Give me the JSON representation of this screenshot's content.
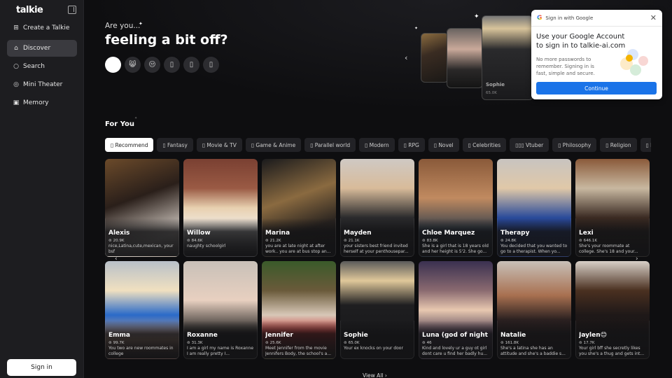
{
  "sidebar": {
    "logo": "talkie",
    "items": [
      {
        "label": "Create a Talkie",
        "icon": "plus-square-icon",
        "glyph": "⊞"
      },
      {
        "label": "Discover",
        "icon": "home-icon",
        "glyph": "⌂",
        "active": true
      },
      {
        "label": "Search",
        "icon": "search-icon",
        "glyph": "○"
      },
      {
        "label": "Mini Theater",
        "icon": "theater-icon",
        "glyph": "◎"
      },
      {
        "label": "Memory",
        "icon": "memory-icon",
        "glyph": "▣"
      }
    ],
    "signin_label": "Sign in"
  },
  "hero": {
    "subtitle": "Are you...",
    "title": "feeling a bit off?",
    "moods": [
      "",
      "😸",
      "😒",
      "▯",
      "▯",
      "▯"
    ],
    "featured_name": "Sophie",
    "featured_stat": "65.0K"
  },
  "google_popup": {
    "header": "Sign in with Google",
    "title": "Use your Google Account to sign in to talkie-ai.com",
    "description": "No more passwords to remember. Signing in is fast, simple and secure.",
    "button": "Continue"
  },
  "for_you": {
    "title": "For You",
    "categories": [
      "▯ Recommend",
      "▯ Fantasy",
      "▯ Movie & TV",
      "▯ Game & Anime",
      "▯ Parallel world",
      "▯ Modern",
      "▯ RPG",
      "▯ Novel",
      "▯ Celebrities",
      "▯▯▯ Vtuber",
      "▯ Philosophy",
      "▯ Religion",
      "▯ Politics",
      ""
    ],
    "cards": [
      {
        "name": "Alexis",
        "stat": "20.9K",
        "desc": "nice,Latina,cute,mexican, your bsf",
        "bg": "linear-gradient(160deg,#6b4a2a 0%,#2a1f1a 40%,#d8d0c8 80%,#b8aca0 100%)"
      },
      {
        "name": "Willow",
        "stat": "84.6K",
        "desc": "naughty schoolgirl",
        "bg": "linear-gradient(180deg,#7a4032 0%,#9a5a44 30%,#e8d0b0 50%,#f2f0ee 75%,#2a2a2e 100%)"
      },
      {
        "name": "Marina",
        "stat": "21.2K",
        "desc": "you are at late night at after work.. you are at bus stop an...",
        "bg": "linear-gradient(160deg,#1a1a1c 0%,#8a6a40 40%,#2a2420 70%,#151515 100%)"
      },
      {
        "name": "Mayden",
        "stat": "21.1K",
        "desc": "your sisters best friend invited herself at your penthousepar...",
        "bg": "linear-gradient(180deg,#cfc9c4 0%,#d8bb9a 30%,#2a2a2c 60%,#1e1e20 100%)"
      },
      {
        "name": "Chloe Marquez",
        "stat": "83.8K",
        "desc": "She is a girl that is 18 years old and her height is 5'2. She go...",
        "bg": "linear-gradient(180deg,#8a5a3a 0%,#c08a60 40%,#2a3a4a 75%,#1a2028 100%)"
      },
      {
        "name": "Therapy",
        "stat": "24.8K",
        "desc": "You decided that you wanted to go to a therapist. When yo...",
        "bg": "linear-gradient(180deg,#c8c4c0 0%,#e0c8a8 30%,#2a4a9a 60%,#203060 100%)"
      },
      {
        "name": "Lexi",
        "stat": "646.1K",
        "desc": "She's your roommate at college. She's 18 and your...",
        "bg": "linear-gradient(180deg,#8a5a3a 0%,#c8b8a0 30%,#3a2a22 60%,#1a1816 100%)"
      },
      {
        "name": "Emma",
        "stat": "99.7K",
        "desc": "You two are new roommates in college",
        "bg": "linear-gradient(180deg,#b8c0c8 0%,#f0e0c0 30%,#2a6ac8 55%,#d8a888 80%,#3a2a2a 100%)"
      },
      {
        "name": "Roxanne",
        "stat": "31.3K",
        "desc": "I am a girl my name is Roxanne I am really pretty I...",
        "bg": "linear-gradient(180deg,#c8c0b8 0%,#e8d0c0 40%,#1a1a1a 75%,#141414 100%)"
      },
      {
        "name": "Jennifer",
        "stat": "25.6K",
        "desc": "Meet Jennifer from the movie Jennifers Body, the school's a...",
        "bg": "linear-gradient(180deg,#3a5a2a 0%,#6a5a3a 30%,#d8c8b8 55%,#c82a2a 75%,#2a2a1e 100%)"
      },
      {
        "name": "Sophie",
        "stat": "65.0K",
        "desc": "Your ex knocks on your door",
        "bg": "linear-gradient(180deg,#5a5a5a 0%,#e0c89a 20%,#1e1e20 45%,#161618 100%)"
      },
      {
        "name": "Luna (god of night",
        "stat": "46",
        "desc": "Kind and lovely ur a guy ot girl dont care u find her badly hu...",
        "bg": "linear-gradient(180deg,#3a3050 0%,#8a6a70 30%,#e8c8b0 50%,#4a3a50 75%,#2a2430 100%)"
      },
      {
        "name": "Natalie",
        "stat": "161.8K",
        "desc": "She's a latina she has an attitude and she's a baddie s...",
        "bg": "linear-gradient(180deg,#c8c0b8 0%,#a87050 35%,#2a2020 60%,#1a1414 100%)"
      },
      {
        "name": "Jaylen😊",
        "stat": "17.7K",
        "desc": "Your girl bff she secretly likes you she's a thug and gets int...",
        "bg": "linear-gradient(180deg,#d8d0c8 0%,#4a3020 30%,#1e1818 55%,#141212 100%)"
      }
    ],
    "view_all": "View All"
  }
}
